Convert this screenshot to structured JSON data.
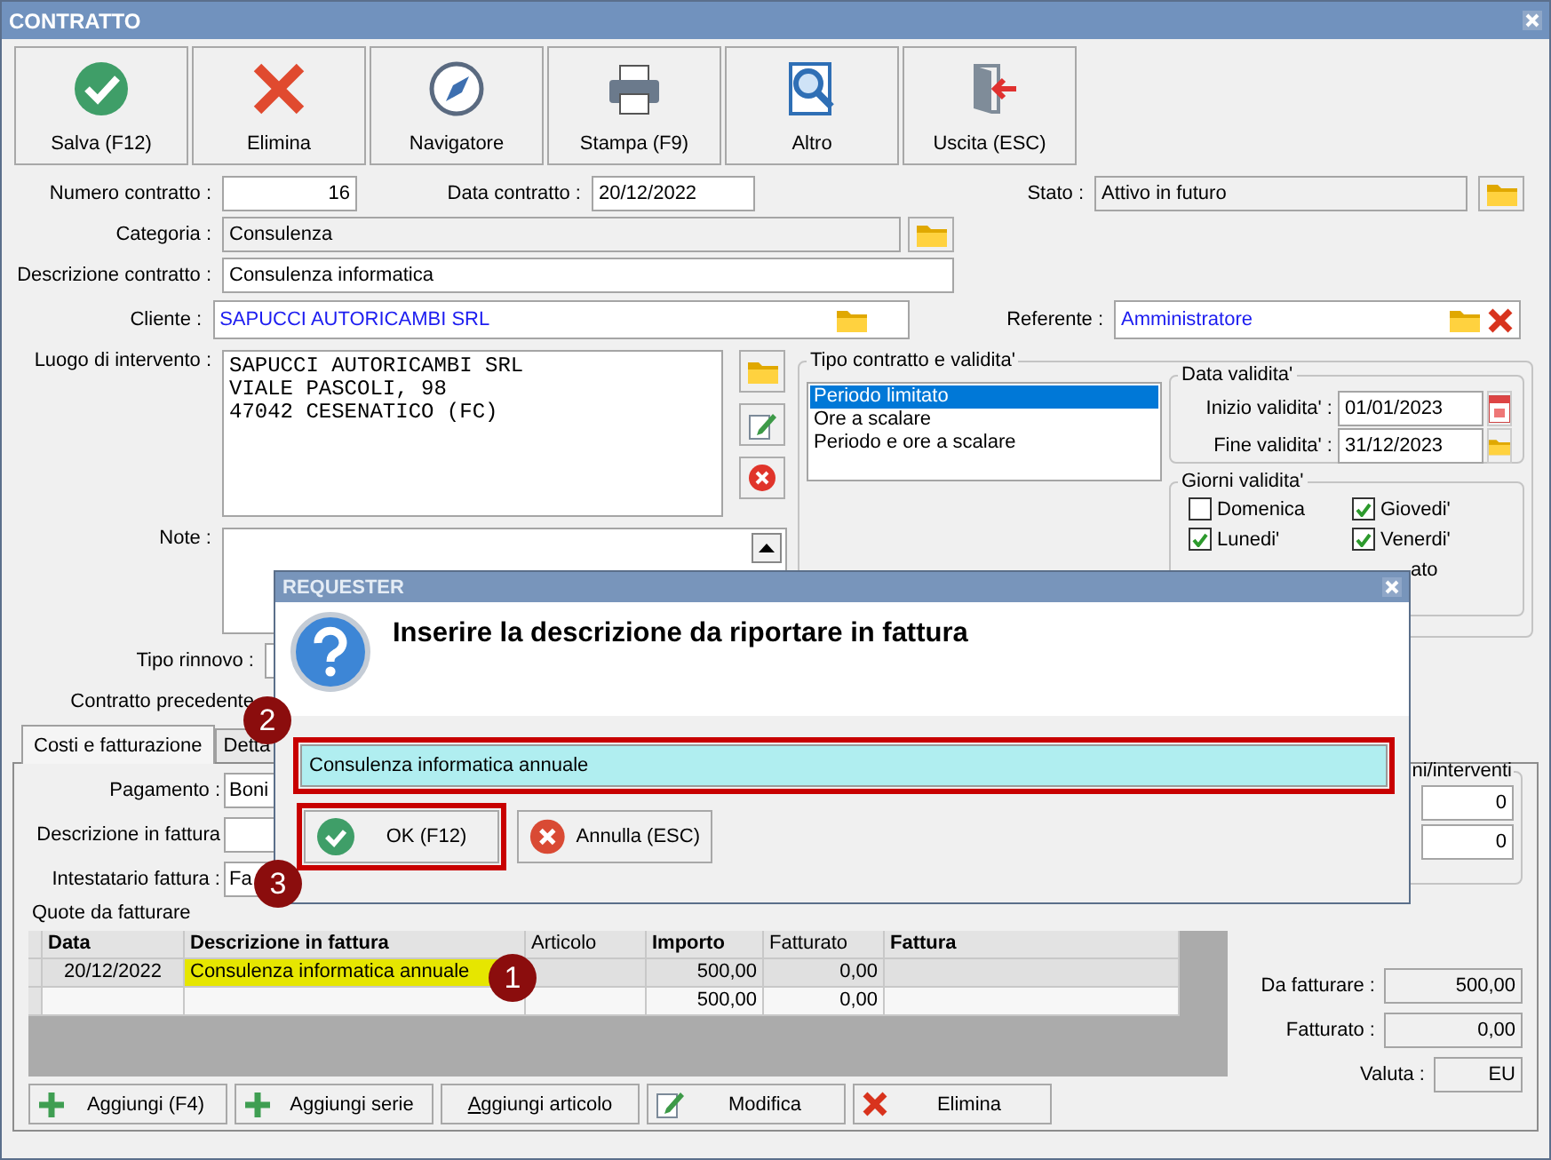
{
  "window": {
    "title": "CONTRATTO"
  },
  "toolbar": [
    {
      "label": "Salva (F12)",
      "kind": "save"
    },
    {
      "label": "Elimina",
      "kind": "delete"
    },
    {
      "label": "Navigatore",
      "kind": "compass"
    },
    {
      "label": "Stampa (F9)",
      "kind": "print"
    },
    {
      "label": "Altro",
      "kind": "search"
    },
    {
      "label": "Uscita (ESC)",
      "kind": "exit"
    }
  ],
  "header": {
    "numero": {
      "label": "Numero contratto :",
      "value": "16"
    },
    "data": {
      "label": "Data contratto :",
      "value": "20/12/2022"
    },
    "stato": {
      "label": "Stato :",
      "value": "Attivo in futuro"
    },
    "categoria": {
      "label": "Categoria :",
      "value": "Consulenza"
    },
    "descrizione": {
      "label": "Descrizione contratto :",
      "value": "Consulenza informatica"
    },
    "cliente": {
      "label": "Cliente :",
      "value": "SAPUCCI AUTORICAMBI SRL"
    },
    "referente": {
      "label": "Referente :",
      "value": "Amministratore"
    },
    "luogo": {
      "label": "Luogo di intervento :",
      "lines": [
        "SAPUCCI AUTORICAMBI SRL",
        "VIALE PASCOLI, 98",
        "47042 CESENATICO (FC)"
      ]
    },
    "note": {
      "label": "Note :"
    },
    "tipo_rinnovo": {
      "label": "Tipo rinnovo :"
    },
    "contratto_precedente": {
      "label": "Contratto precedente"
    }
  },
  "tipo_contratto": {
    "title": "Tipo contratto e validita'",
    "options": [
      {
        "label": "Periodo limitato",
        "selected": true
      },
      {
        "label": "Ore a scalare",
        "selected": false
      },
      {
        "label": "Periodo e ore a scalare",
        "selected": false
      }
    ],
    "data_validita": {
      "title": "Data validita'",
      "inizio": {
        "label": "Inizio validita' :",
        "value": "01/01/2023"
      },
      "fine": {
        "label": "Fine validita' :",
        "value": "31/12/2023"
      }
    },
    "giorni": {
      "title": "Giorni validita'",
      "days": [
        {
          "label": "Domenica",
          "checked": false
        },
        {
          "label": "Giovedi'",
          "checked": true
        },
        {
          "label": "Lunedi'",
          "checked": true
        },
        {
          "label": "Venerdi'",
          "checked": true
        }
      ],
      "partial_label": "ato"
    }
  },
  "tabs": [
    {
      "label": "Costi e fatturazione",
      "selected": true
    },
    {
      "label": "Detta",
      "selected": false
    }
  ],
  "billing": {
    "pagamento": {
      "label": "Pagamento :",
      "value": "Boni"
    },
    "descrizione": {
      "label": "Descrizione in fattura"
    },
    "intestatario": {
      "label": "Intestatario fattura :",
      "value": "Fa"
    },
    "counters": {
      "title": "ni/interventi",
      "values": [
        "0",
        "0"
      ]
    },
    "quote": {
      "title": "Quote da fatturare",
      "columns": [
        {
          "label": "Data",
          "bold": true
        },
        {
          "label": "Descrizione in fattura",
          "bold": true
        },
        {
          "label": "Articolo",
          "bold": false
        },
        {
          "label": "Importo",
          "bold": true
        },
        {
          "label": "Fatturato",
          "bold": false
        },
        {
          "label": "Fattura",
          "bold": true
        }
      ],
      "rows": [
        {
          "selected": true,
          "date": "20/12/2022",
          "description": "Consulenza informatica annuale",
          "description_highlighted": true,
          "amount": "500,00",
          "invoiced": "0,00"
        },
        {
          "selected": false,
          "description_highlighted": false,
          "amount": "500,00",
          "invoiced": "0,00"
        }
      ]
    },
    "totals": [
      {
        "label": "Da fatturare :",
        "value": "500,00"
      },
      {
        "label": "Fatturato :",
        "value": "0,00"
      },
      {
        "label": "Valuta :",
        "value": "EU"
      }
    ],
    "buttons": [
      {
        "label": "Aggiungi (F4)",
        "kind": "add"
      },
      {
        "label": "Aggiungi serie",
        "kind": "add"
      },
      {
        "label": "Aggiungi articolo",
        "kind": "underlined"
      },
      {
        "label": "Modifica",
        "kind": "edit"
      },
      {
        "label": "Elimina",
        "kind": "delete"
      }
    ]
  },
  "dialog": {
    "title": "REQUESTER",
    "message": "Inserire la descrizione da riportare in fattura",
    "field": {
      "value": "Consulenza informatica annuale",
      "highlighted": true
    },
    "buttons": [
      {
        "label": "OK (F12)",
        "kind": "ok",
        "highlighted": true
      },
      {
        "label": "Annulla (ESC)",
        "kind": "cancel",
        "highlighted": false
      }
    ]
  },
  "callouts": [
    {
      "number": "1"
    },
    {
      "number": "2"
    },
    {
      "number": "3"
    }
  ]
}
